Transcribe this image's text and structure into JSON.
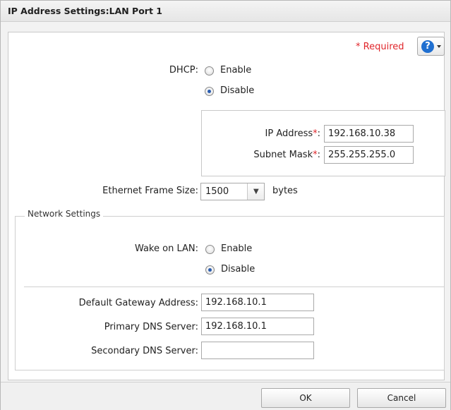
{
  "dialog": {
    "title": "IP Address Settings:LAN Port 1"
  },
  "header": {
    "required_star": "*",
    "required_label": "Required",
    "help_glyph": "?"
  },
  "dhcp": {
    "label": "DHCP:",
    "options": [
      "Enable",
      "Disable"
    ],
    "selected": "Disable"
  },
  "ip_address": {
    "label": "IP Address",
    "star": "*",
    "colon": ":",
    "value": "192.168.10.38"
  },
  "subnet_mask": {
    "label": "Subnet Mask",
    "star": "*",
    "colon": ":",
    "value": "255.255.255.0"
  },
  "frame_size": {
    "label": "Ethernet Frame Size:",
    "value": "1500",
    "unit": "bytes"
  },
  "network_settings": {
    "legend": "Network Settings",
    "wake_on_lan": {
      "label": "Wake on LAN:",
      "options": [
        "Enable",
        "Disable"
      ],
      "selected": "Disable"
    },
    "default_gateway": {
      "label": "Default Gateway Address:",
      "value": "192.168.10.1"
    },
    "primary_dns": {
      "label": "Primary DNS Server:",
      "value": "192.168.10.1"
    },
    "secondary_dns": {
      "label": "Secondary DNS Server:",
      "value": ""
    }
  },
  "footer": {
    "ok_label": "OK",
    "cancel_label": "Cancel"
  },
  "icons": {
    "help": "help-icon",
    "dropdown": "chevron-down-icon"
  },
  "colors": {
    "required": "#e0262b",
    "help": "#1f6fd0",
    "radio_selected": "#2a5db0"
  }
}
